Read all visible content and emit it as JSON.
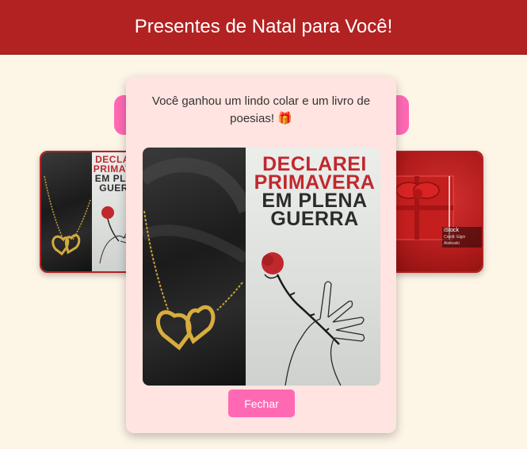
{
  "header": {
    "title": "Presentes de Natal para Você!"
  },
  "modal": {
    "message": "Você ganhou um lindo colar e um livro de poesias! 🎁",
    "close_label": "Fechar",
    "book_title_lines": [
      "DECLAREI",
      "PRIMAVERA",
      "EM PLENA",
      "GUERRA"
    ]
  },
  "left_card": {
    "book_title_lines": [
      "DECLAREI",
      "PRIMAVERA",
      "EM PLENA",
      "GUERRA"
    ]
  },
  "right_card": {
    "watermark": "iStock",
    "watermark_credit": "Credit: Elgin Aistkoski"
  },
  "colors": {
    "header_bg": "#b22222",
    "page_bg": "#fdf5e6",
    "accent_pink": "#ff69b4",
    "modal_bg": "#ffe4e1",
    "book_red": "#c0282d"
  }
}
